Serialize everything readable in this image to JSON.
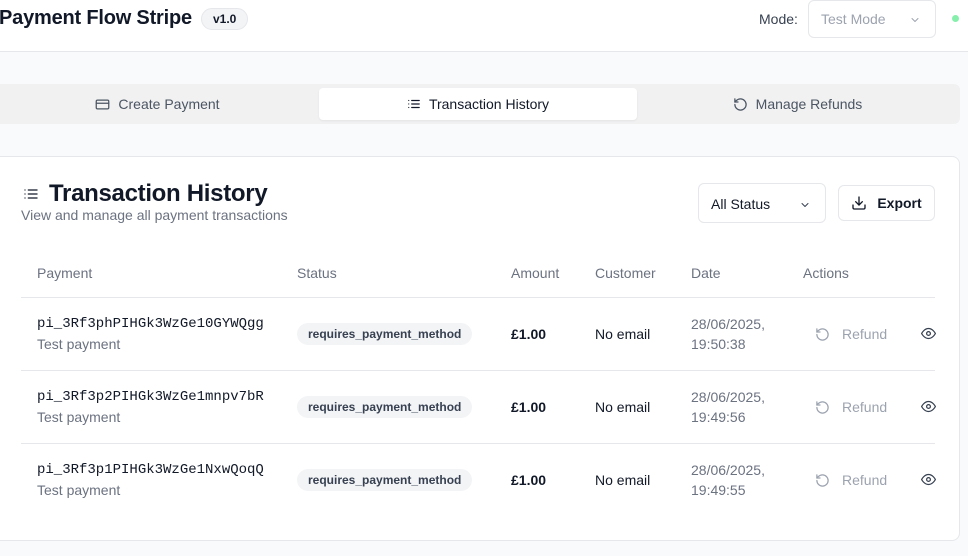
{
  "header": {
    "title": "Payment Flow Stripe",
    "version": "v1.0",
    "mode_label": "Mode:",
    "mode_value": "Test Mode",
    "status_color": "#86efac"
  },
  "tabs": [
    {
      "label": "Create Payment",
      "icon": "credit-card-icon",
      "active": false
    },
    {
      "label": "Transaction History",
      "icon": "list-icon",
      "active": true
    },
    {
      "label": "Manage Refunds",
      "icon": "rotate-ccw-icon",
      "active": false
    }
  ],
  "card": {
    "title": "Transaction History",
    "subtitle": "View and manage all payment transactions",
    "status_filter": "All Status",
    "export_label": "Export"
  },
  "table": {
    "headers": [
      "Payment",
      "Status",
      "Amount",
      "Customer",
      "Date",
      "Actions"
    ],
    "rows": [
      {
        "id": "pi_3Rf3phPIHGk3WzGe10GYWQgg",
        "description": "Test payment",
        "status": "requires_payment_method",
        "amount": "£1.00",
        "customer": "No email",
        "date_line1": "28/06/2025,",
        "date_line2": "19:50:38",
        "action": "Refund"
      },
      {
        "id": "pi_3Rf3p2PIHGk3WzGe1mnpv7bR",
        "description": "Test payment",
        "status": "requires_payment_method",
        "amount": "£1.00",
        "customer": "No email",
        "date_line1": "28/06/2025,",
        "date_line2": "19:49:56",
        "action": "Refund"
      },
      {
        "id": "pi_3Rf3p1PIHGk3WzGe1NxwQoqQ",
        "description": "Test payment",
        "status": "requires_payment_method",
        "amount": "£1.00",
        "customer": "No email",
        "date_line1": "28/06/2025,",
        "date_line2": "19:49:55",
        "action": "Refund"
      }
    ]
  }
}
